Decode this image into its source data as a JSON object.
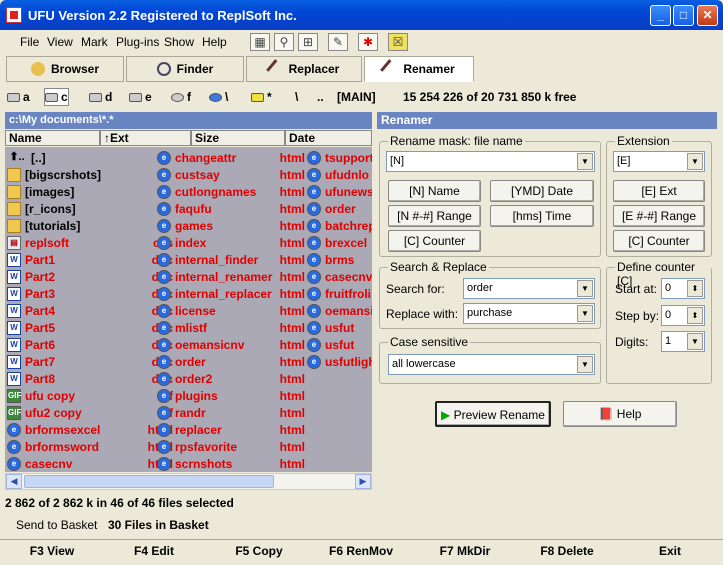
{
  "window": {
    "title": "UFU Version 2.2 Registered to ReplSoft Inc."
  },
  "menu": [
    "File",
    "View",
    "Mark",
    "Plug-ins",
    "Show",
    "Help"
  ],
  "tabs": [
    "Browser",
    "Finder",
    "Replacer",
    "Renamer"
  ],
  "drives": [
    "a",
    "c",
    "d",
    "e",
    "f",
    "\\",
    "*",
    "\\",
    "..",
    "[MAIN]"
  ],
  "free_space": "15 254 226 of 20 731 850 k free",
  "path": "c:\\My documents\\*.*",
  "columns": [
    "Name",
    "↑Ext",
    "Size",
    "Date"
  ],
  "files_col1": [
    {
      "name": "[..]",
      "ext": "",
      "icon": "up"
    },
    {
      "name": "[bigscrshots]",
      "ext": "",
      "icon": "folder"
    },
    {
      "name": "[images]",
      "ext": "",
      "icon": "folder"
    },
    {
      "name": "[r_icons]",
      "ext": "",
      "icon": "folder"
    },
    {
      "name": "[tutorials]",
      "ext": "",
      "icon": "folder"
    },
    {
      "name": "replsoft",
      "ext": "css",
      "icon": "css"
    },
    {
      "name": "Part1",
      "ext": "doc",
      "icon": "doc"
    },
    {
      "name": "Part2",
      "ext": "doc",
      "icon": "doc"
    },
    {
      "name": "Part3",
      "ext": "doc",
      "icon": "doc"
    },
    {
      "name": "Part4",
      "ext": "doc",
      "icon": "doc"
    },
    {
      "name": "Part5",
      "ext": "doc",
      "icon": "doc"
    },
    {
      "name": "Part6",
      "ext": "doc",
      "icon": "doc"
    },
    {
      "name": "Part7",
      "ext": "doc",
      "icon": "doc"
    },
    {
      "name": "Part8",
      "ext": "doc",
      "icon": "doc"
    },
    {
      "name": "ufu copy",
      "ext": "gif",
      "icon": "gif"
    },
    {
      "name": "ufu2 copy",
      "ext": "gif",
      "icon": "gif"
    },
    {
      "name": "brformsexcel",
      "ext": "html",
      "icon": "ie"
    },
    {
      "name": "brformsword",
      "ext": "html",
      "icon": "ie"
    },
    {
      "name": "casecnv",
      "ext": "html",
      "icon": "ie"
    }
  ],
  "files_col2": [
    {
      "name": "changeattr",
      "ext": "html"
    },
    {
      "name": "custsay",
      "ext": "html"
    },
    {
      "name": "cutlongnames",
      "ext": "html"
    },
    {
      "name": "faqufu",
      "ext": "html"
    },
    {
      "name": "games",
      "ext": "html"
    },
    {
      "name": "index",
      "ext": "html"
    },
    {
      "name": "internal_finder",
      "ext": "html"
    },
    {
      "name": "internal_renamer",
      "ext": "html"
    },
    {
      "name": "internal_replacer",
      "ext": "html"
    },
    {
      "name": "license",
      "ext": "html"
    },
    {
      "name": "mlistf",
      "ext": "html"
    },
    {
      "name": "oemansicnv",
      "ext": "html"
    },
    {
      "name": "order",
      "ext": "html"
    },
    {
      "name": "order2",
      "ext": "html"
    },
    {
      "name": "plugins",
      "ext": "html"
    },
    {
      "name": "randr",
      "ext": "html"
    },
    {
      "name": "replacer",
      "ext": "html"
    },
    {
      "name": "rpsfavorite",
      "ext": "html"
    },
    {
      "name": "scrnshots",
      "ext": "html"
    }
  ],
  "files_col3": [
    "tsupport",
    "ufudnlo",
    "ufunews",
    "order",
    "batchrep",
    "brexcel",
    "brms",
    "casecnv",
    "fruitfroli",
    "oemansi",
    "usfut",
    "usfut",
    "usfutligh"
  ],
  "status": "2 862 of 2 862 k in 46 of 46 files selected",
  "basket": {
    "send_label": "Send to Basket",
    "count": "30 Files in Basket"
  },
  "renamer": {
    "header": "Renamer",
    "mask_label": "Rename mask: file name",
    "mask_value": "[N]",
    "mask_buttons": [
      "[N] Name",
      "[YMD] Date",
      "[N #-#] Range",
      "[hms] Time",
      "[C] Counter"
    ],
    "ext_label": "Extension",
    "ext_value": "[E]",
    "ext_buttons": [
      "[E] Ext",
      "[E #-#] Range",
      "[C] Counter"
    ],
    "sr_label": "Search & Replace",
    "search_label": "Search for:",
    "search_value": "order",
    "replace_label": "Replace with:",
    "replace_value": "purchase",
    "case_label": "Case sensitive",
    "case_value": "all lowercase",
    "counter_label": "Define counter [C]",
    "start_label": "Start at:",
    "start_value": "0",
    "step_label": "Step by:",
    "step_value": "0",
    "digits_label": "Digits:",
    "digits_value": "1",
    "preview_label": "Preview Rename",
    "help_label": "Help"
  },
  "fkeys": [
    "F3 View",
    "F4 Edit",
    "F5 Copy",
    "F6 RenMov",
    "F7 MkDir",
    "F8 Delete",
    "Exit"
  ]
}
